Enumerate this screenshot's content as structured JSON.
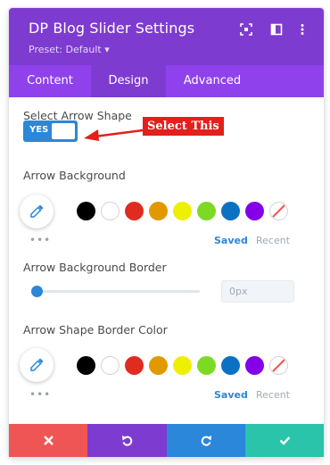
{
  "header": {
    "title": "DP Blog Slider Settings",
    "preset": "Preset: Default ▾",
    "icons": [
      "expand-icon",
      "sidebar-layout-icon",
      "more-vertical-icon"
    ],
    "background": "#7e3bd0"
  },
  "tabs": [
    {
      "label": "Content",
      "active": false
    },
    {
      "label": "Design",
      "active": true
    },
    {
      "label": "Advanced",
      "active": false
    }
  ],
  "arrow_shape": {
    "label": "Select Arrow Shape",
    "toggle_text": "YES",
    "enabled": true
  },
  "annotation": {
    "text": "Select This",
    "color": "#e3201b"
  },
  "arrow_background": {
    "label": "Arrow Background",
    "swatches": [
      "#000000",
      "#ffffff",
      "#e02b20",
      "#e09900",
      "#edf000",
      "#7cda24",
      "#0c71c3",
      "#8300e9",
      "none"
    ],
    "saved_label": "Saved",
    "recent_label": "Recent",
    "more": "•••"
  },
  "arrow_background_border": {
    "label": "Arrow Background Border",
    "value": "0px",
    "slider_fraction": 0
  },
  "arrow_shape_border_color": {
    "label": "Arrow Shape Border Color",
    "swatches": [
      "#000000",
      "#ffffff",
      "#e02b20",
      "#e09900",
      "#edf000",
      "#7cda24",
      "#0c71c3",
      "#8300e9",
      "none"
    ],
    "saved_label": "Saved",
    "recent_label": "Recent",
    "more": "•••"
  },
  "footer": {
    "buttons": [
      {
        "icon": "close-icon",
        "color": "#ef5555"
      },
      {
        "icon": "undo-icon",
        "color": "#7e3bd0"
      },
      {
        "icon": "redo-icon",
        "color": "#2b87da"
      },
      {
        "icon": "check-icon",
        "color": "#29c4a9"
      }
    ]
  }
}
